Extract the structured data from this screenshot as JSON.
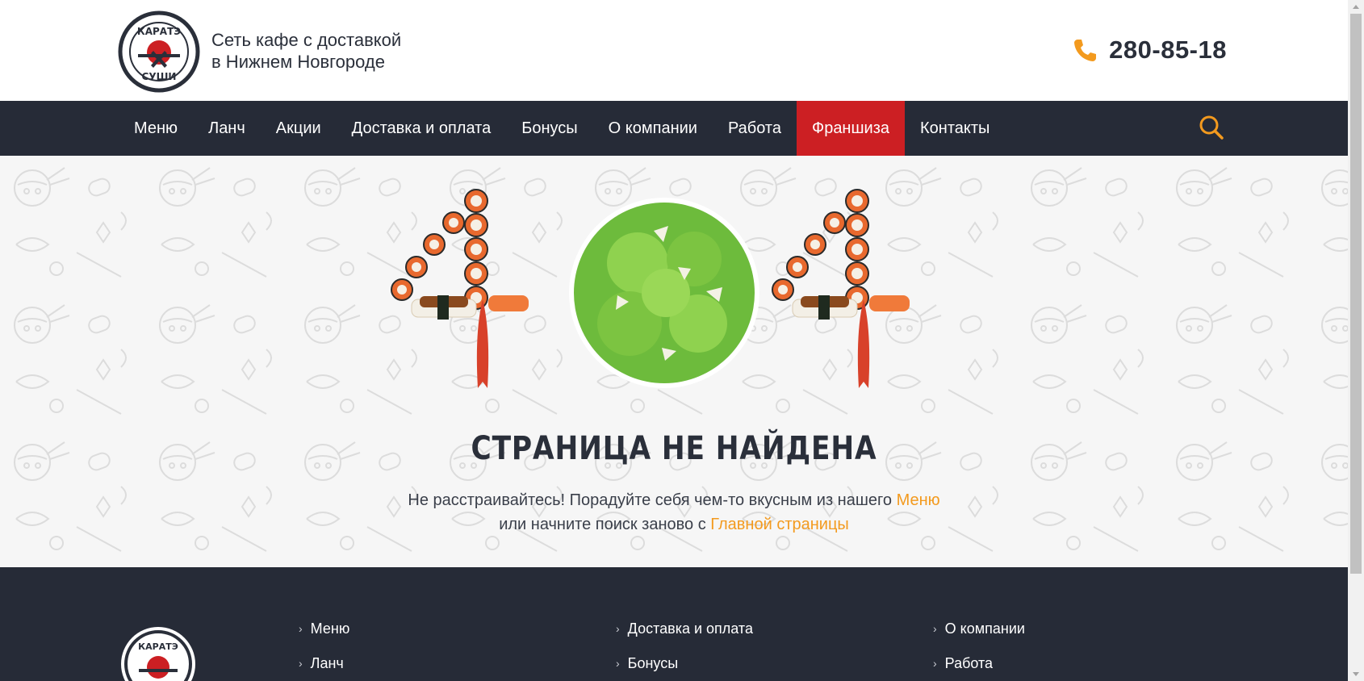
{
  "header": {
    "tagline_line1": "Сеть кафе с доставкой",
    "tagline_line2": "в Нижнем Новгороде",
    "phone": "280-85-18",
    "logo_text_top": "КАРАТЭ",
    "logo_text_bottom": "СУШИ",
    "icons": {
      "phone": "phone-icon",
      "logo": "karate-sushi-logo"
    }
  },
  "nav": {
    "items": [
      {
        "label": "Меню"
      },
      {
        "label": "Ланч"
      },
      {
        "label": "Акции"
      },
      {
        "label": "Доставка и оплата"
      },
      {
        "label": "Бонусы"
      },
      {
        "label": "О компании"
      },
      {
        "label": "Работа"
      },
      {
        "label": "Франшиза",
        "active": true
      },
      {
        "label": "Контакты"
      }
    ],
    "search_icon": "search-icon"
  },
  "error": {
    "title": "СТРАНИЦА НЕ НАЙДЕНА",
    "line1_prefix": "Не расстраивайтесь! Порадуйте себя чем-то вкусным из нашего ",
    "line1_link": "Меню",
    "line2_prefix": "или начните поиск заново с ",
    "line2_link": "Главной страницы"
  },
  "footer": {
    "col1": [
      "Меню",
      "Ланч"
    ],
    "col2": [
      "Доставка и оплата",
      "Бонусы"
    ],
    "col3": [
      "О компании",
      "Работа"
    ]
  },
  "colors": {
    "nav_bg": "#262b37",
    "accent_red": "#cc1f23",
    "accent_orange": "#f39a1e",
    "text_dark": "#2a2f3a"
  }
}
